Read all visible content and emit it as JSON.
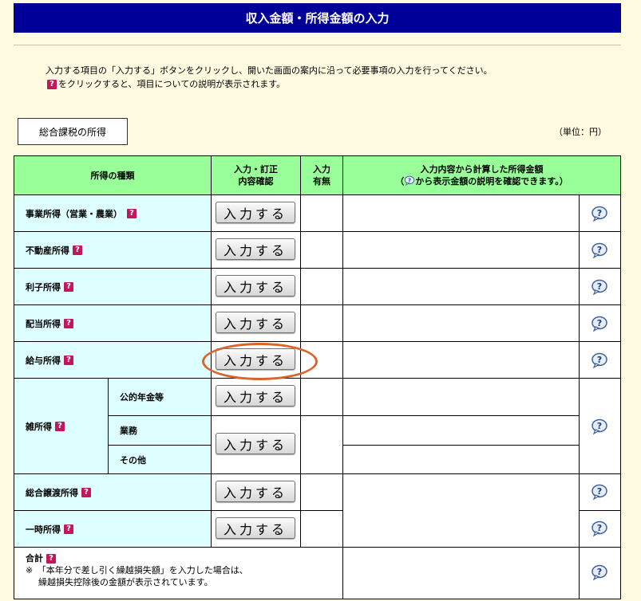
{
  "page": {
    "title": "収入金額・所得金額の入力",
    "instruction_line1": "入力する項目の「入力する」ボタンをクリックし、開いた画面の案内に沿って必要事項の入力を行ってください。",
    "instruction_line2": "をクリックすると、項目についての説明が表示されます。",
    "tab_label": "総合課税の所得",
    "unit_label": "（単位：円）"
  },
  "table": {
    "header": {
      "type": "所得の種類",
      "entry_line1": "入力・訂正",
      "entry_line2": "内容確認",
      "has_input_line1": "入力",
      "has_input_line2": "有無",
      "amount_line1": "入力内容から計算した所得金額",
      "amount_line2_pre": "（",
      "amount_line2_post": "から表示金額の説明を確認できます。）"
    },
    "button_label": "入力する",
    "rows": [
      {
        "label": "事業所得（営業・農業）"
      },
      {
        "label": "不動産所得"
      },
      {
        "label": "利子所得"
      },
      {
        "label": "配当所得"
      },
      {
        "label": "給与所得"
      },
      {
        "label": "雑所得",
        "subs": [
          "公的年金等",
          "業務",
          "その他"
        ]
      },
      {
        "label": "総合譲渡所得"
      },
      {
        "label": "一時所得"
      }
    ],
    "total": {
      "label": "合計",
      "note_line1": "※　「本年分で差し引く繰越損失額」を入力した場合は、",
      "note_line2": "繰越損失控除後の金額が表示されています。"
    }
  },
  "icons": {
    "help_icon": "speech-bubble-question-icon",
    "info_icon": "red-question-icon"
  }
}
